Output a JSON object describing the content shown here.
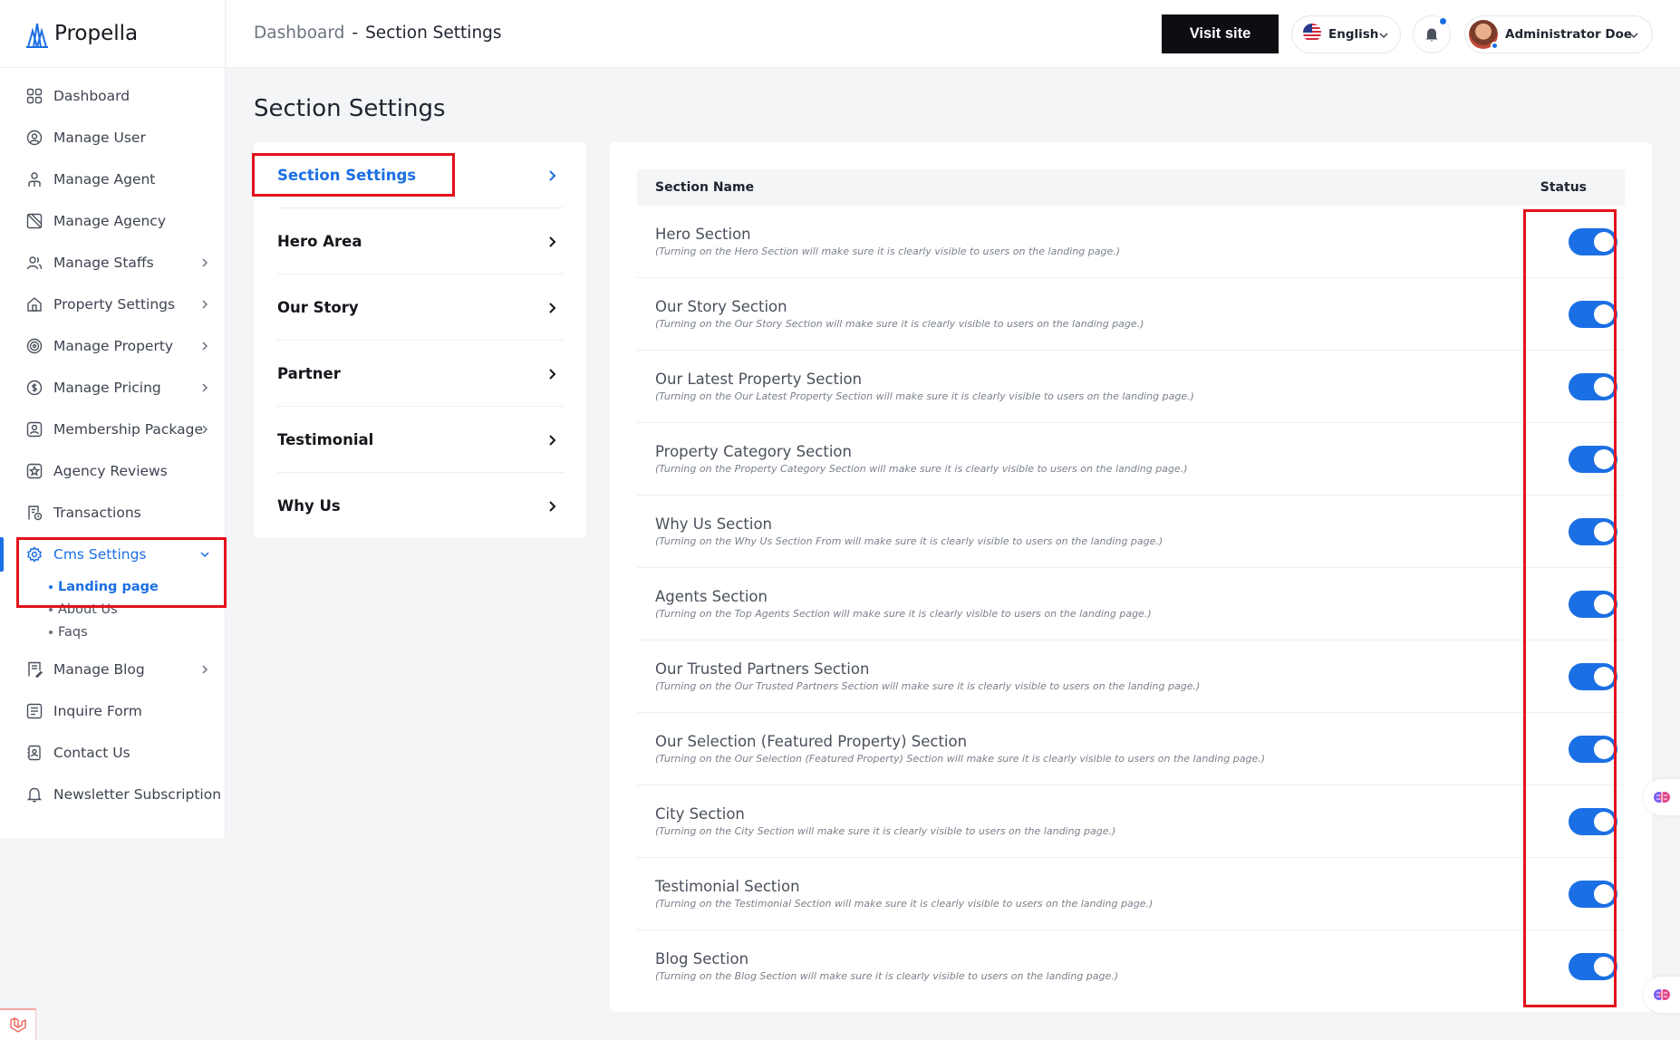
{
  "brand": {
    "name": "Propella"
  },
  "sidebar": {
    "items": [
      {
        "label": "Dashboard"
      },
      {
        "label": "Manage User"
      },
      {
        "label": "Manage Agent"
      },
      {
        "label": "Manage Agency"
      },
      {
        "label": "Manage Staffs"
      },
      {
        "label": "Property Settings"
      },
      {
        "label": "Manage Property"
      },
      {
        "label": "Manage Pricing"
      },
      {
        "label": "Membership Package"
      },
      {
        "label": "Agency Reviews"
      },
      {
        "label": "Transactions"
      },
      {
        "label": "Cms Settings"
      },
      {
        "label": "Manage Blog"
      },
      {
        "label": "Inquire Form"
      },
      {
        "label": "Contact Us"
      },
      {
        "label": "Newsletter Subscription"
      }
    ],
    "cms_sub": [
      "Landing page",
      "About Us",
      "Faqs"
    ]
  },
  "header": {
    "crumb_root": "Dashboard",
    "crumb_sep": "-",
    "crumb_current": "Section Settings",
    "visit_label": "Visit site",
    "language": "English",
    "user_name": "Administrator Doe"
  },
  "main": {
    "title": "Section Settings",
    "tabs": [
      "Section Settings",
      "Hero Area",
      "Our Story",
      "Partner",
      "Testimonial",
      "Why Us"
    ],
    "table": {
      "col_name": "Section Name",
      "col_status": "Status",
      "rows": [
        {
          "name": "Hero Section",
          "desc": "(Turning on the Hero Section will make sure it is clearly visible to users on the landing page.)"
        },
        {
          "name": "Our Story Section",
          "desc": "(Turning on the Our Story Section will make sure it is clearly visible to users on the landing page.)"
        },
        {
          "name": "Our Latest Property Section",
          "desc": "(Turning on the Our Latest Property Section will make sure it is clearly visible to users on the landing page.)"
        },
        {
          "name": "Property Category Section",
          "desc": "(Turning on the Property Category Section will make sure it is clearly visible to users on the landing page.)"
        },
        {
          "name": "Why Us Section",
          "desc": "(Turning on the Why Us Section From will make sure it is clearly visible to users on the landing page.)"
        },
        {
          "name": "Agents Section",
          "desc": "(Turning on the Top Agents Section will make sure it is clearly visible to users on the landing page.)"
        },
        {
          "name": "Our Trusted Partners Section",
          "desc": "(Turning on the Our Trusted Partners Section will make sure it is clearly visible to users on the landing page.)"
        },
        {
          "name": "Our Selection (Featured Property) Section",
          "desc": "(Turning on the Our Selection (Featured Property) Section will make sure it is clearly visible to users on the landing page.)"
        },
        {
          "name": "City Section",
          "desc": "(Turning on the City Section will make sure it is clearly visible to users on the landing page.)"
        },
        {
          "name": "Testimonial Section",
          "desc": "(Turning on the Testimonial Section will make sure it is clearly visible to users on the landing page.)"
        },
        {
          "name": "Blog Section",
          "desc": "(Turning on the Blog Section will make sure it is clearly visible to users on the landing page.)"
        }
      ]
    }
  },
  "colors": {
    "accent": "#1b6fe4",
    "highlight": "#e3111b",
    "dark_button": "#0d0e12"
  },
  "icons": {
    "sidebar": [
      "grid-icon",
      "user-circle-icon",
      "agent-icon",
      "agency-icon",
      "staff-icon",
      "home-icon",
      "property-icon",
      "pricing-icon",
      "membership-icon",
      "star-icon",
      "receipt-icon",
      "gear-icon",
      "blog-icon",
      "form-icon",
      "contact-icon",
      "bell-icon"
    ]
  }
}
